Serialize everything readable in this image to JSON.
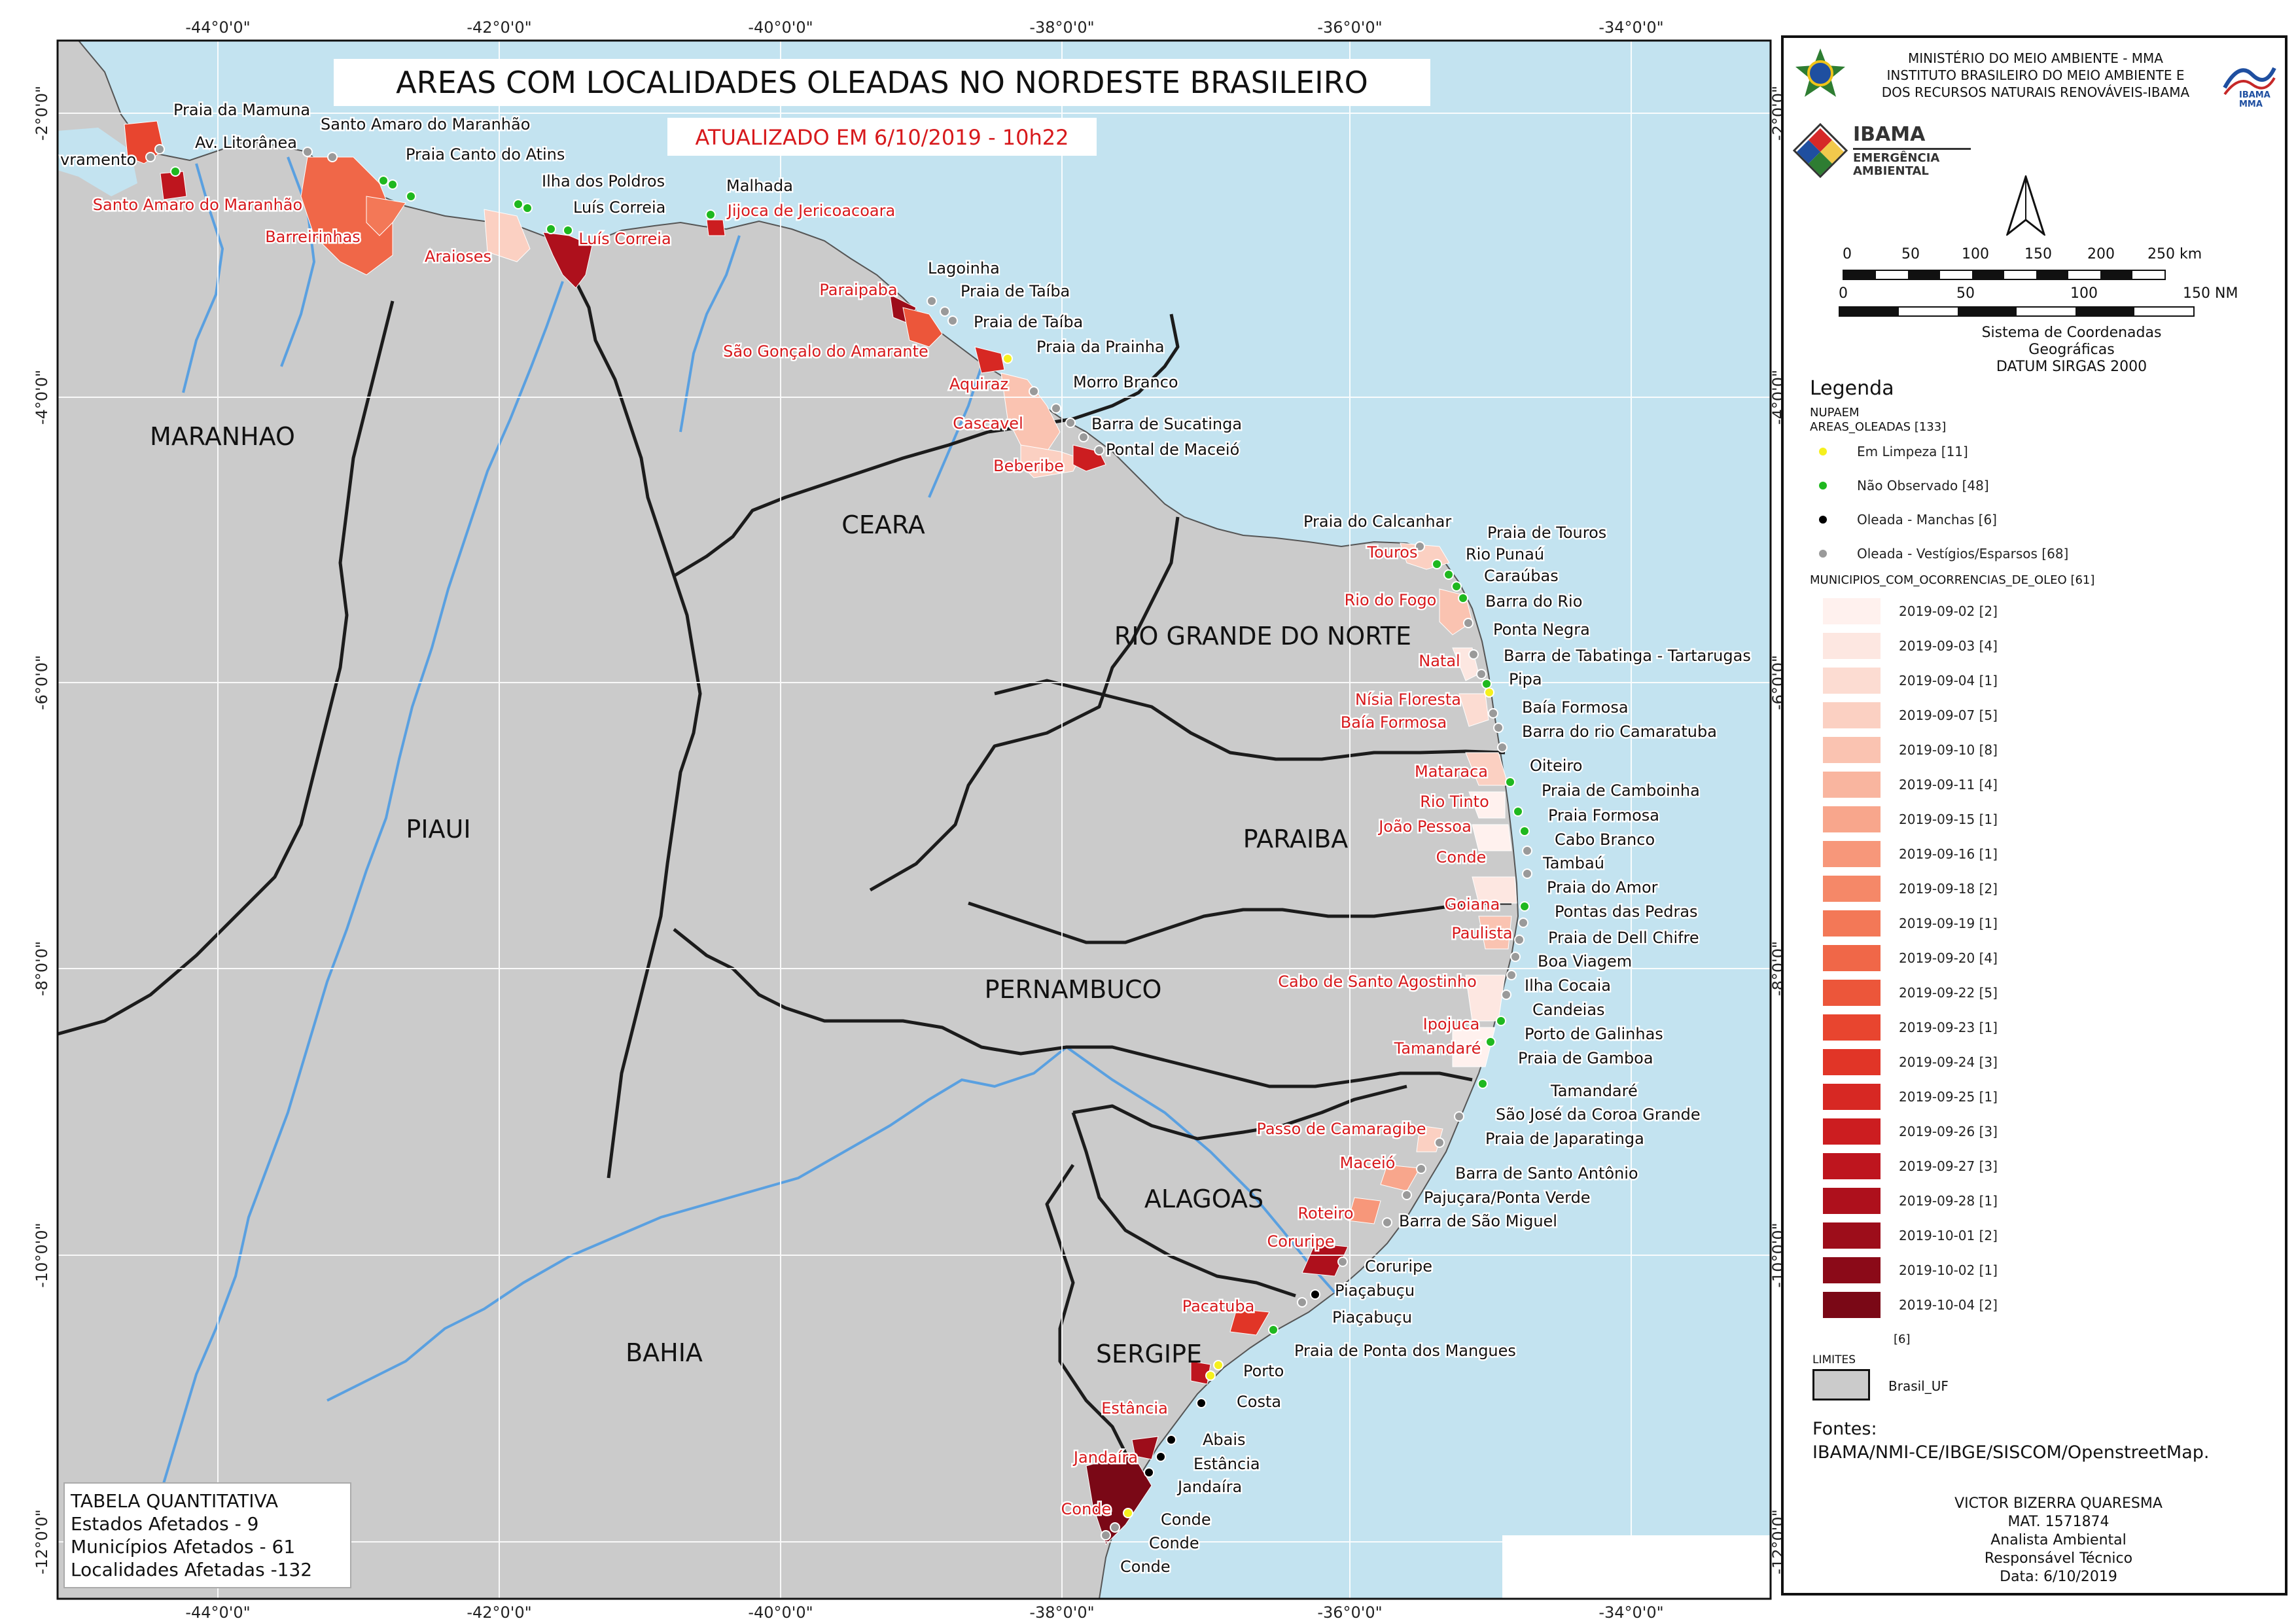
{
  "title": "AREAS COM LOCALIDADES OLEADAS NO NORDESTE BRASILEIRO",
  "subtitle": "ATUALIZADO EM 6/10/2019 - 10h22",
  "graticule": {
    "lon_labels": [
      "-44°0'0\"",
      "-42°0'0\"",
      "-40°0'0\"",
      "-38°0'0\"",
      "-36°0'0\"",
      "-34°0'0\""
    ],
    "lat_labels": [
      "-2°0'0\"",
      "-4°0'0\"",
      "-6°0'0\"",
      "-8°0'0\"",
      "-10°0'0\"",
      "-12°0'0\""
    ]
  },
  "states": [
    "MARANHAO",
    "CEARA",
    "PIAUI",
    "RIO GRANDE DO NORTE",
    "PARAIBA",
    "PERNAMBUCO",
    "ALAGOAS",
    "SERGIPE",
    "BAHIA"
  ],
  "municipalities": [
    "Santo Amaro do Maranhão",
    "Barreirinhas",
    "Araioses",
    "Luís Correia",
    "Jijoca de Jericoacoara",
    "Paraipaba",
    "São Gonçalo do Amarante",
    "Aquiraz",
    "Cascavel",
    "Beberibe",
    "Touros",
    "Rio do Fogo",
    "Natal",
    "Nísia Floresta",
    "Baía Formosa",
    "Mataraca",
    "Rio Tinto",
    "João Pessoa",
    "Conde",
    "Goiana",
    "Paulista",
    "Cabo de Santo Agostinho",
    "Ipojuca",
    "Tamandaré",
    "Passo de Camaragibe",
    "Maceió",
    "Roteiro",
    "Coruripe",
    "Pacatuba",
    "Estância",
    "Jandaíra",
    "Conde"
  ],
  "localities": [
    "vramento",
    "Praia da Mamuna",
    "Av. Litorânea",
    "Santo Amaro do Maranhão",
    "Praia Canto do Atins",
    "Ilha dos Poldros",
    "Luís Correia",
    "Malhada",
    "Lagoinha",
    "Praia de Taíba",
    "Praia de Taíba",
    "Praia da Prainha",
    "Morro Branco",
    "Barra de Sucatinga",
    "Pontal de Maceió",
    "Praia do Calcanhar",
    "Praia de Touros",
    "Rio Punaú",
    "Caraúbas",
    "Barra do Rio",
    "Ponta Negra",
    "Barra de Tabatinga - Tartarugas",
    "Pipa",
    "Baía Formosa",
    "Barra do rio Camaratuba",
    "Oiteiro",
    "Praia de Camboinha",
    "Praia Formosa",
    "Cabo Branco",
    "Tambaú",
    "Praia do Amor",
    "Pontas das Pedras",
    "Praia de Dell Chifre",
    "Boa Viagem",
    "Ilha Cocaia",
    "Candeias",
    "Porto de Galinhas",
    "Praia de Gamboa",
    "Tamandaré",
    "São José da Coroa Grande",
    "Praia de Japaratinga",
    "Barra de Santo Antônio",
    "Pajuçara/Ponta Verde",
    "Barra de São Miguel",
    "Coruripe",
    "Piaçabuçu",
    "Piaçabuçu",
    "Praia de Ponta dos Mangues",
    "Porto",
    "Costa",
    "Abais",
    "Estância",
    "Jandaíra",
    "Conde",
    "Conde",
    "Conde"
  ],
  "summary_table": {
    "title": "TABELA QUANTITATIVA",
    "rows": [
      "Estados Afetados - 9",
      "Municípios Afetados - 61",
      "Localidades Afetadas -132"
    ]
  },
  "panel": {
    "agency_lines": [
      "MINISTÉRIO DO MEIO AMBIENTE - MMA",
      "INSTITUTO BRASILEIRO DO MEIO AMBIENTE E",
      "DOS RECURSOS NATURAIS RENOVÁVEIS-IBAMA"
    ],
    "logo_ibama_small": "IBAMA",
    "logo_mma_small": "MMA",
    "emergency_logo": [
      "IBAMA",
      "EMERGÊNCIA",
      "AMBIENTAL"
    ],
    "north_arrow_icon": "north-arrow-icon",
    "scale_km_labels": [
      "0",
      "50",
      "100",
      "150",
      "200",
      "250 km"
    ],
    "scale_nm_labels": [
      "0",
      "50",
      "100",
      "150 NM"
    ],
    "crs_lines": [
      "Sistema de Coordenadas",
      "Geográficas",
      "DATUM SIRGAS 2000"
    ],
    "legend_title": "Legenda",
    "legend_group1": [
      "NUPAEM",
      "AREAS_OLEADAS [133]"
    ],
    "point_legend": [
      {
        "label": "Em Limpeza [11]",
        "color": "#f5f01e"
      },
      {
        "label": "Não Observado [48]",
        "color": "#1fb81f"
      },
      {
        "label": "Oleada - Manchas [6]",
        "color": "#000000"
      },
      {
        "label": "Oleada - Vestígios/Esparsos [68]",
        "color": "#9a9a9a"
      }
    ],
    "legend_group2": "MUNICIPIOS_COM_OCORRENCIAS_DE_OLEO [61]",
    "poly_legend": [
      {
        "label": "2019-09-02 [2]",
        "color": "#fff1ee"
      },
      {
        "label": "2019-09-03 [4]",
        "color": "#fde7e1"
      },
      {
        "label": "2019-09-04 [1]",
        "color": "#fcdcd2"
      },
      {
        "label": "2019-09-07 [5]",
        "color": "#fbd0c2"
      },
      {
        "label": "2019-09-10 [8]",
        "color": "#fac3b1"
      },
      {
        "label": "2019-09-11 [4]",
        "color": "#f9b59f"
      },
      {
        "label": "2019-09-15 [1]",
        "color": "#f8a68c"
      },
      {
        "label": "2019-09-16 [1]",
        "color": "#f7977a"
      },
      {
        "label": "2019-09-18 [2]",
        "color": "#f58868"
      },
      {
        "label": "2019-09-19 [1]",
        "color": "#f37857"
      },
      {
        "label": "2019-09-20 [4]",
        "color": "#f06748"
      },
      {
        "label": "2019-09-22 [5]",
        "color": "#ec563a"
      },
      {
        "label": "2019-09-23 [1]",
        "color": "#e8452f"
      },
      {
        "label": "2019-09-24 [3]",
        "color": "#e13527"
      },
      {
        "label": "2019-09-25 [1]",
        "color": "#d72823"
      },
      {
        "label": "2019-09-26 [3]",
        "color": "#cc1d20"
      },
      {
        "label": "2019-09-27 [3]",
        "color": "#be151e"
      },
      {
        "label": "2019-09-28 [1]",
        "color": "#ae101c"
      },
      {
        "label": "2019-10-01 [2]",
        "color": "#9d0d1a"
      },
      {
        "label": "2019-10-02 [1]",
        "color": "#8b0a18"
      },
      {
        "label": "2019-10-04 [2]",
        "color": "#7a0816"
      }
    ],
    "extra_count": "[6]",
    "limits_title": "LIMITES",
    "limits_label": "Brasil_UF",
    "sources_title": "Fontes:",
    "sources": "IBAMA/NMI-CE/IBGE/SISCOM/OpenstreetMap.",
    "author_lines": [
      "VICTOR BIZERRA QUARESMA",
      "MAT. 1571874",
      "Analista Ambiental",
      "Responsável Técnico",
      "Data: 6/10/2019"
    ]
  },
  "colors": {
    "ocean": "#c3e3f0",
    "land": "#cbcbcb",
    "state_border": "#1c1c1c",
    "river": "#5aa0e0",
    "affected_label": "#d7191c",
    "title_border": "#ffffff"
  }
}
